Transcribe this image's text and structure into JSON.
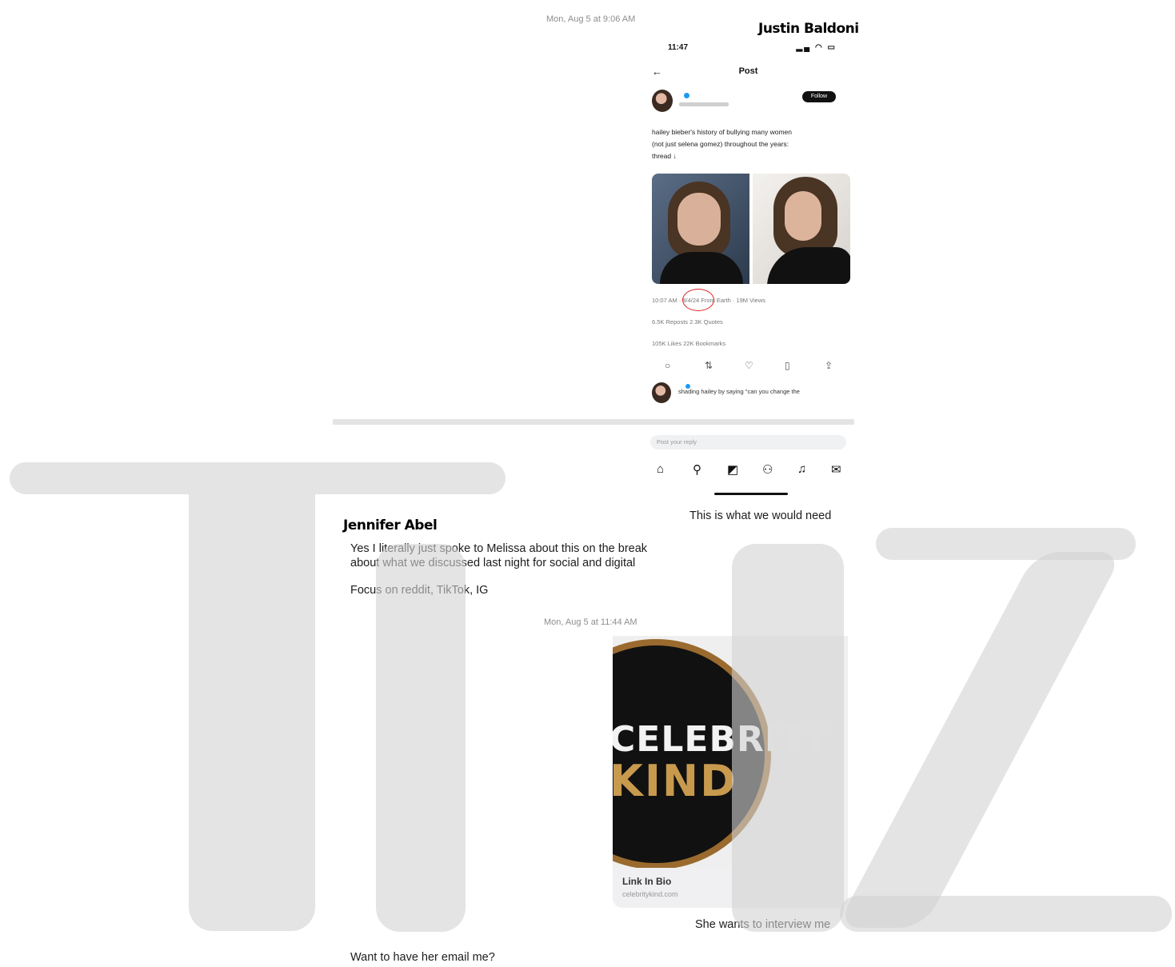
{
  "thread": {
    "timestamp_1": "Mon, Aug 5 at 9:06 AM",
    "timestamp_2": "Mon, Aug 5 at 11:44 AM",
    "sender_right": "Justin Baldoni",
    "sender_left": "Jennifer Abel",
    "msg_need": "This is what we would need",
    "msg_reply_1a": "Yes I literally just spoke to Melissa about this on the break",
    "msg_reply_1b": "about what we discussed last night for social and digital",
    "msg_reply_2": "Focus on reddit, TikTok, IG",
    "msg_interview": "She wants to interview me",
    "msg_email": "Want to have her email me?"
  },
  "embedded_post": {
    "status_time": "11:47",
    "status_icons": "▂▄ ◠ ▭",
    "title": "Post",
    "follow_label": "Follow",
    "text_line_1": "hailey bieber's history of bullying many women",
    "text_line_2": "(not just selena gomez) throughout the years:",
    "text_line_3": "thread ↓",
    "stat_line_1": "10:07 AM · 8/4/24 From Earth · 19M Views",
    "stat_line_2": "6.5K Reposts 2.3K Quotes",
    "stat_line_3": "105K Likes 22K Bookmarks",
    "reply_line": "shading hailey by saying \"can you change the",
    "reply_placeholder": "Post your reply"
  },
  "link_preview": {
    "logo_line_1": "CELEBRITY",
    "logo_line_2": "KIND",
    "title": "Link In Bio",
    "url": "celebritykind.com"
  },
  "watermark": {
    "text": "TMZ",
    "color": "#d2d2d2"
  },
  "icons": [
    "back-arrow-icon",
    "verified-icon",
    "reply-icon",
    "repost-icon",
    "like-icon",
    "bookmark-icon",
    "share-icon",
    "home-icon",
    "search-icon",
    "grok-icon",
    "communities-icon",
    "notifications-icon",
    "messages-icon"
  ]
}
